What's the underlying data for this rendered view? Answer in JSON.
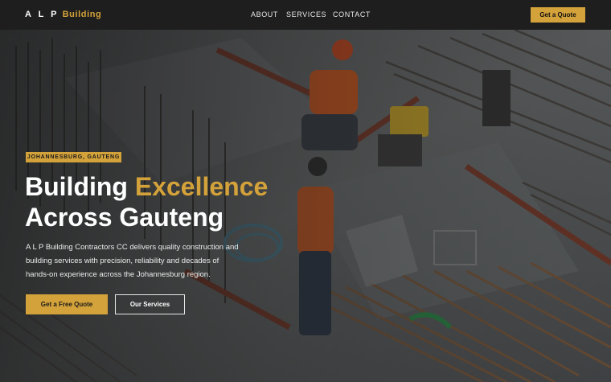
{
  "nav": {
    "logo_part1": "A L P",
    "logo_part2": "Building",
    "links": [
      "ABOUT",
      "SERVICES",
      "CONTACT"
    ],
    "cta": "Get a Quote"
  },
  "hero": {
    "badge": "JOHANNESBURG, GAUTENG",
    "headline_line1_white": "Building ",
    "headline_line1_gold": "Excellence",
    "headline_line2": "Across Gauteng",
    "description": "A L P Building Contractors CC delivers quality construction and building services with precision, reliability and decades of hands-on experience across the Johannesburg region.",
    "primary_button": "Get a Free Quote",
    "secondary_button": "Our Services",
    "background_image": "construction-site-workers-photo"
  },
  "colors": {
    "accent": "#d4a23a",
    "nav_background": "#1e1e1e",
    "text": "#ffffff"
  }
}
